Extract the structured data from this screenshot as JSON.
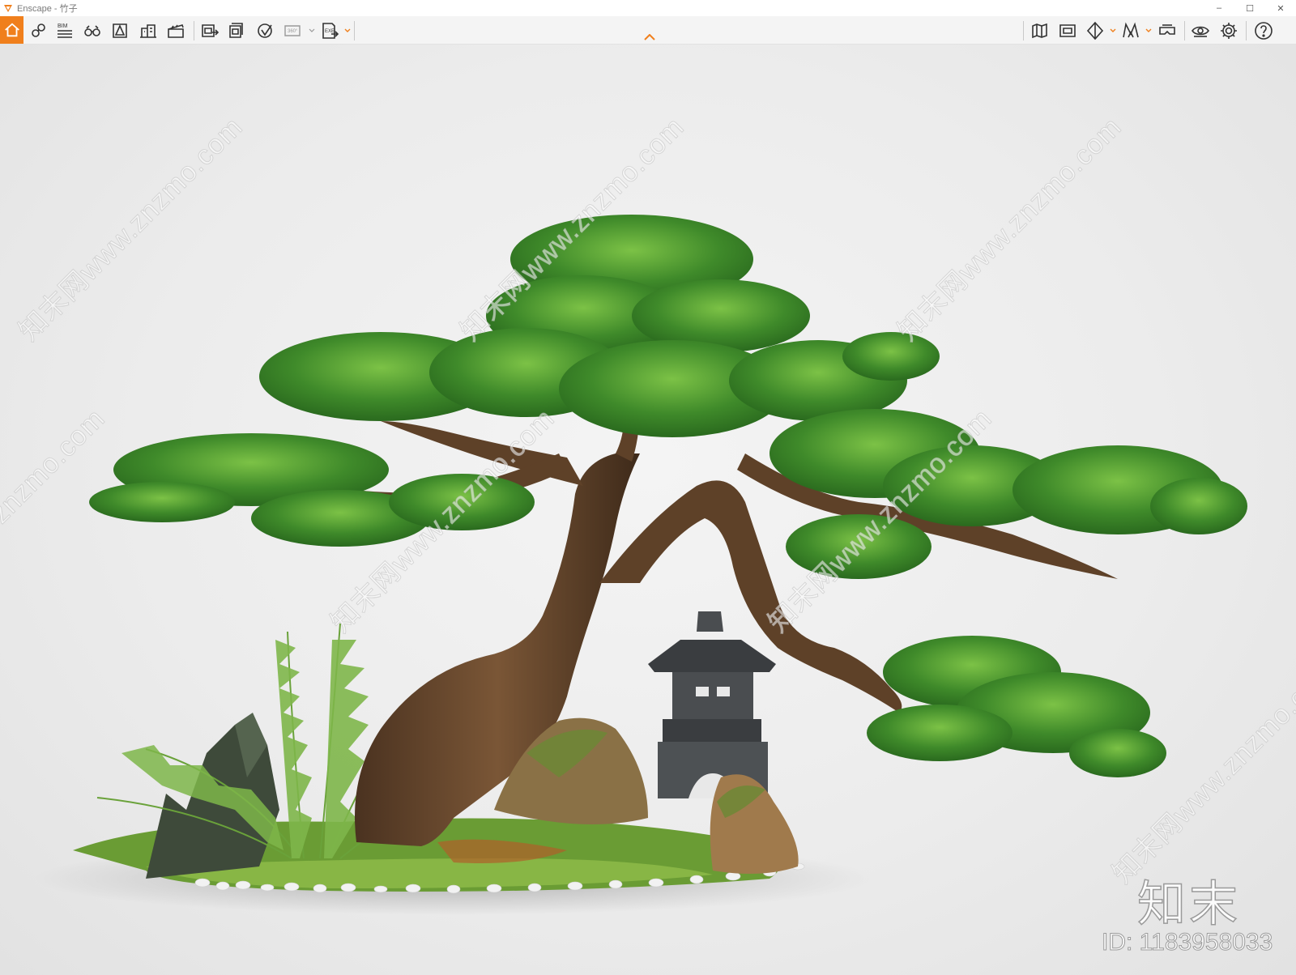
{
  "window": {
    "title": "Enscape - 竹子",
    "controls": {
      "minimize": "–",
      "maximize": "☐",
      "close": "✕"
    }
  },
  "toolbar": {
    "left_buttons": [
      {
        "icon": "home-icon"
      },
      {
        "icon": "map-pin-icon"
      },
      {
        "icon": "bim-icon",
        "label": "BIM"
      },
      {
        "icon": "binoculars-icon"
      },
      {
        "icon": "asset-library-icon"
      },
      {
        "icon": "buildings-icon"
      },
      {
        "icon": "clapperboard-icon"
      },
      {
        "icon": "screenshot-export-icon"
      },
      {
        "icon": "batch-export-icon"
      },
      {
        "icon": "upload-icon"
      },
      {
        "icon": "panorama-360-icon",
        "label": "360°"
      },
      {
        "icon": "exe-export-icon",
        "label": "EXE"
      }
    ],
    "right_buttons": [
      {
        "icon": "map-icon"
      },
      {
        "icon": "capture-view-icon"
      },
      {
        "icon": "cube-view-icon"
      },
      {
        "icon": "material-icon"
      },
      {
        "icon": "vr-headset-icon"
      },
      {
        "icon": "eye-icon"
      },
      {
        "icon": "settings-gear-icon"
      },
      {
        "icon": "help-icon"
      }
    ],
    "accent_color": "#f07f1c"
  },
  "viewport": {
    "watermark_text": "知末网www.znzmo.com",
    "logo_text": "知末",
    "id_text": "ID: 1183958033"
  }
}
